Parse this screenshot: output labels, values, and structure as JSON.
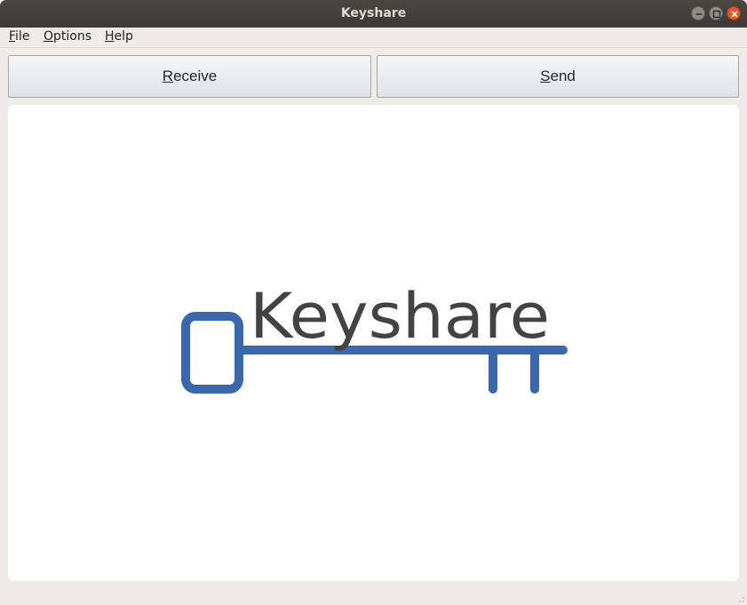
{
  "window": {
    "title": "Keyshare"
  },
  "menubar": {
    "file": {
      "mnemonic": "F",
      "rest": "ile"
    },
    "options": {
      "mnemonic": "O",
      "rest": "ptions"
    },
    "help": {
      "mnemonic": "H",
      "rest": "elp"
    }
  },
  "actions": {
    "receive": {
      "mnemonic": "R",
      "rest": "eceive"
    },
    "send": {
      "mnemonic": "S",
      "rest": "end"
    }
  },
  "logo": {
    "text": "Keyshare",
    "text_color": "#434343",
    "key_color": "#3a68ad"
  },
  "colors": {
    "titlebar": "#3c3b37",
    "window_bg": "#efebe7",
    "close_button": "#e95420"
  }
}
